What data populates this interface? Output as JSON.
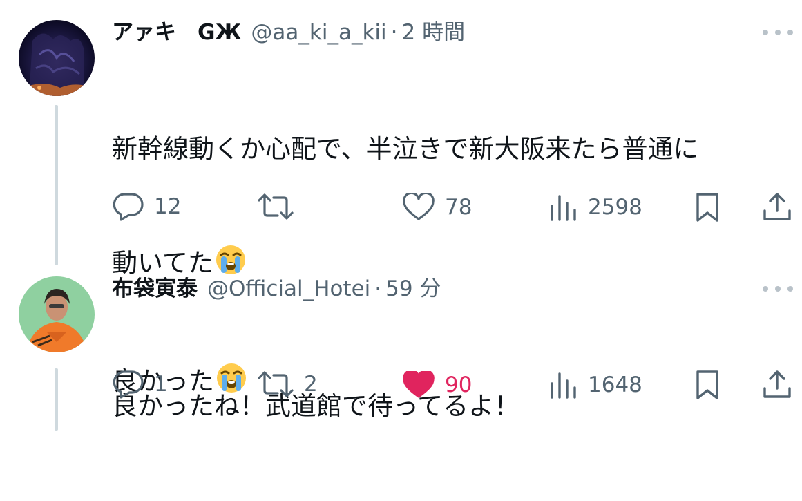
{
  "colors": {
    "text": "#0f1419",
    "muted": "#536471",
    "like": "#e0245e",
    "thread_line": "#cfd9de"
  },
  "tweets": [
    {
      "name": "アァキ　GЖ",
      "handle": "@aa_ki_a_kii",
      "separator": "·",
      "time": "2 時間",
      "lines": [
        "新幹線動くか心配で、半泣きで新大阪来たら普通に",
        "動いてた",
        "良かった"
      ],
      "emoji": "loudly-crying-face",
      "replies": "12",
      "retweets": "",
      "likes": "78",
      "liked": false,
      "views": "2598"
    },
    {
      "name": "布袋寅泰",
      "handle": "@Official_Hotei",
      "separator": "·",
      "time": "59 分",
      "lines": [
        "良かったね！武道館で待ってるよ！"
      ],
      "replies": "1",
      "retweets": "2",
      "likes": "90",
      "liked": true,
      "views": "1648"
    }
  ]
}
